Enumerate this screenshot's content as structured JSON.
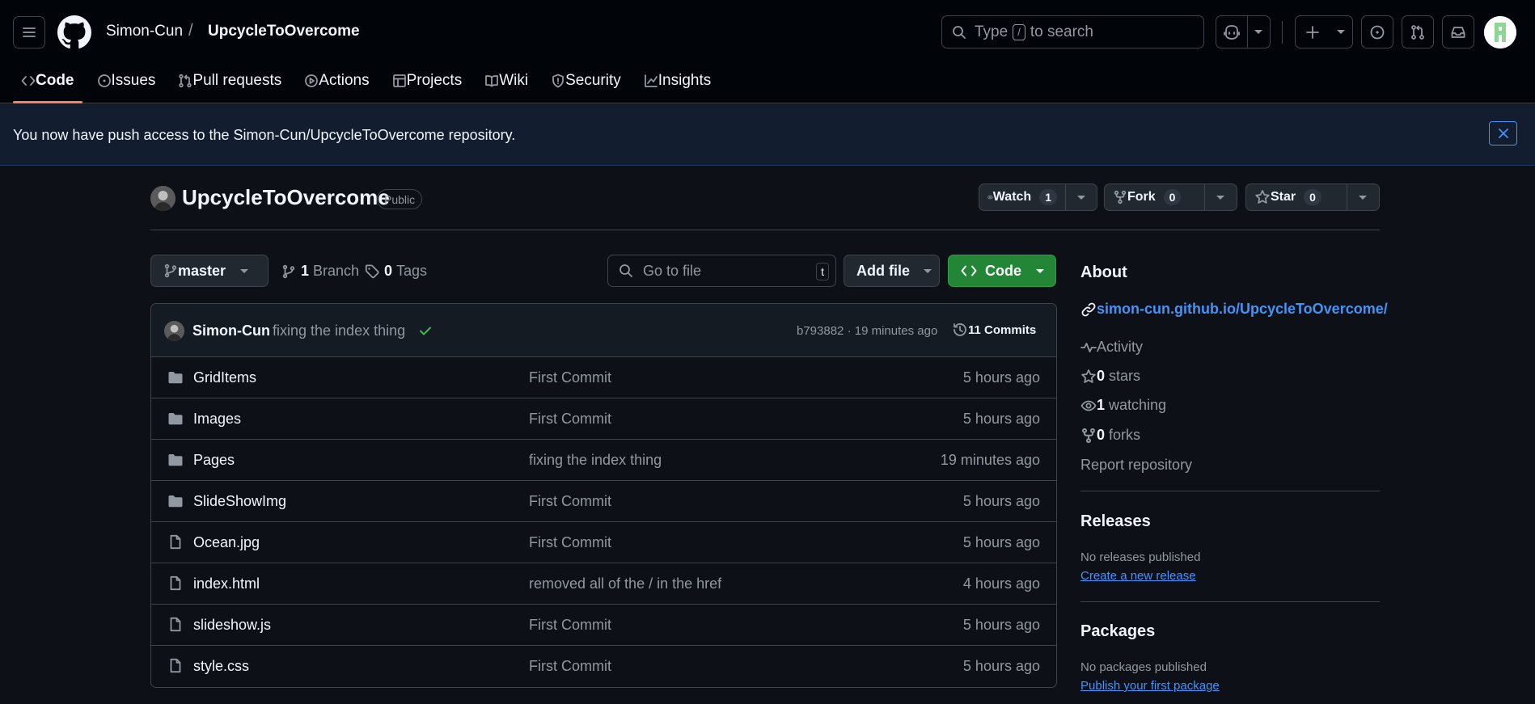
{
  "header": {
    "owner": "Simon-Cun",
    "separator": "/",
    "repo": "UpcycleToOvercome",
    "search_prefix": "Type",
    "search_key": "/",
    "search_suffix": "to search"
  },
  "tabs": [
    {
      "label": "Code",
      "icon": "code-icon",
      "active": true
    },
    {
      "label": "Issues",
      "icon": "issue-icon"
    },
    {
      "label": "Pull requests",
      "icon": "pull-request-icon"
    },
    {
      "label": "Actions",
      "icon": "play-icon"
    },
    {
      "label": "Projects",
      "icon": "table-icon"
    },
    {
      "label": "Wiki",
      "icon": "book-icon"
    },
    {
      "label": "Security",
      "icon": "shield-icon"
    },
    {
      "label": "Insights",
      "icon": "graph-icon"
    }
  ],
  "flash": {
    "message": "You now have push access to the Simon-Cun/UpcycleToOvercome repository."
  },
  "repo": {
    "title": "UpcycleToOvercome",
    "visibility": "Public",
    "watch_label": "Watch",
    "watch_count": "1",
    "fork_label": "Fork",
    "fork_count": "0",
    "star_label": "Star",
    "star_count": "0"
  },
  "toolbar": {
    "branch": "master",
    "branch_count": "1",
    "branch_label": "Branch",
    "tag_count": "0",
    "tag_label": "Tags",
    "goto_placeholder": "Go to file",
    "goto_key": "t",
    "add_file": "Add file",
    "code": "Code"
  },
  "commit": {
    "author": "Simon-Cun",
    "message": "fixing the index thing",
    "meta": "b793882 · 19 minutes ago",
    "count": "11 Commits"
  },
  "files": [
    {
      "name": "GridItems",
      "type": "folder",
      "message": "First Commit",
      "age": "5 hours ago"
    },
    {
      "name": "Images",
      "type": "folder",
      "message": "First Commit",
      "age": "5 hours ago"
    },
    {
      "name": "Pages",
      "type": "folder",
      "message": "fixing the index thing",
      "age": "19 minutes ago"
    },
    {
      "name": "SlideShowImg",
      "type": "folder",
      "message": "First Commit",
      "age": "5 hours ago"
    },
    {
      "name": "Ocean.jpg",
      "type": "file",
      "message": "First Commit",
      "age": "5 hours ago"
    },
    {
      "name": "index.html",
      "type": "file",
      "message": "removed all of the / in the href",
      "age": "4 hours ago"
    },
    {
      "name": "slideshow.js",
      "type": "file",
      "message": "First Commit",
      "age": "5 hours ago"
    },
    {
      "name": "style.css",
      "type": "file",
      "message": "First Commit",
      "age": "5 hours ago"
    }
  ],
  "about": {
    "heading": "About",
    "link": "simon-cun.github.io/UpcycleToOvercome/",
    "activity": "Activity",
    "stars_count": "0",
    "stars_label": "stars",
    "watching_count": "1",
    "watching_label": "watching",
    "forks_count": "0",
    "forks_label": "forks",
    "report": "Report repository"
  },
  "releases": {
    "heading": "Releases",
    "empty": "No releases published",
    "action": "Create a new release"
  },
  "packages": {
    "heading": "Packages",
    "empty": "No packages published",
    "action": "Publish your first package"
  },
  "colors": {
    "accent_green": "#238636",
    "link_blue": "#4493f8",
    "tab_underline": "#f78166",
    "background": "#0d1117"
  }
}
